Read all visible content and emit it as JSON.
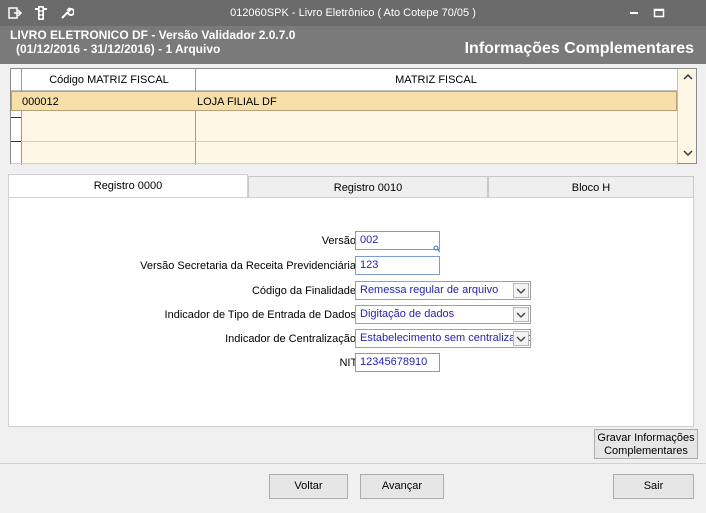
{
  "window": {
    "title": "012060SPK - Livro Eletrônico ( Ato Cotepe 70/05 )",
    "icons": [
      "exit-icon",
      "traffic-light-icon",
      "wrench-icon",
      "minimize-icon",
      "maximize-icon"
    ]
  },
  "header": {
    "line1": "LIVRO ELETRONICO DF - Versão Validador 2.0.7.0",
    "line2": "(01/12/2016 - 31/12/2016) - 1 Arquivo",
    "section_title": "Informações Complementares"
  },
  "grid": {
    "columns": [
      "Código MATRIZ FISCAL",
      "MATRIZ FISCAL"
    ],
    "rows": [
      {
        "codigo": "000012",
        "matriz": "LOJA FILIAL DF"
      }
    ]
  },
  "tabs": [
    {
      "label": "Registro 0000",
      "active": true
    },
    {
      "label": "Registro 0010",
      "active": false
    },
    {
      "label": "Bloco H",
      "active": false
    }
  ],
  "form": {
    "versao": {
      "label": "Versão:",
      "value": "002"
    },
    "versao_srp": {
      "label": "Versão Secretaria da Receita Previdenciária:",
      "value": "123"
    },
    "finalidade": {
      "label": "Código da Finalidade:",
      "value": "Remessa regular de arquivo"
    },
    "tipo_entrada": {
      "label": "Indicador de Tipo de Entrada de Dados:",
      "value": "Digitação de dados"
    },
    "centralizacao": {
      "label": "Indicador de Centralização:",
      "value": "Estabelecimento sem centralização"
    },
    "nit": {
      "label": "NIT:",
      "value": "12345678910"
    }
  },
  "buttons": {
    "gravar_line1": "Gravar Informações",
    "gravar_line2": "Complementares",
    "voltar": "Voltar",
    "avancar": "Avançar",
    "sair": "Sair"
  },
  "colors": {
    "titlebar": "#6b6b6b",
    "header": "#7a7a7a",
    "selected_row": "#f7dfa9",
    "grid_bg": "#fff7e6",
    "field_text": "#2323b4"
  }
}
